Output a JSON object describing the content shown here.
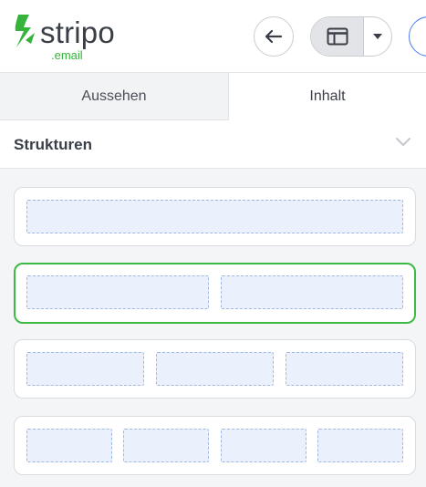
{
  "logo": {
    "word": "stripo",
    "sub": ".email"
  },
  "header": {
    "back_icon": "arrow-left-icon",
    "view_icon": "layout-icon",
    "caret_icon": "caret-down-icon"
  },
  "tabs": [
    {
      "label": "Aussehen",
      "active": false
    },
    {
      "label": "Inhalt",
      "active": true
    }
  ],
  "section": {
    "title": "Strukturen",
    "chevron_icon": "chevron-down-icon",
    "expanded": true
  },
  "structures": [
    {
      "columns": 1,
      "selected": false
    },
    {
      "columns": 2,
      "selected": true
    },
    {
      "columns": 3,
      "selected": false
    },
    {
      "columns": 4,
      "selected": false
    }
  ],
  "colors": {
    "brand_green": "#35b33a",
    "selected_border": "#3dba45",
    "column_fill": "#eaf1fd",
    "column_border": "#9fb8e6"
  }
}
